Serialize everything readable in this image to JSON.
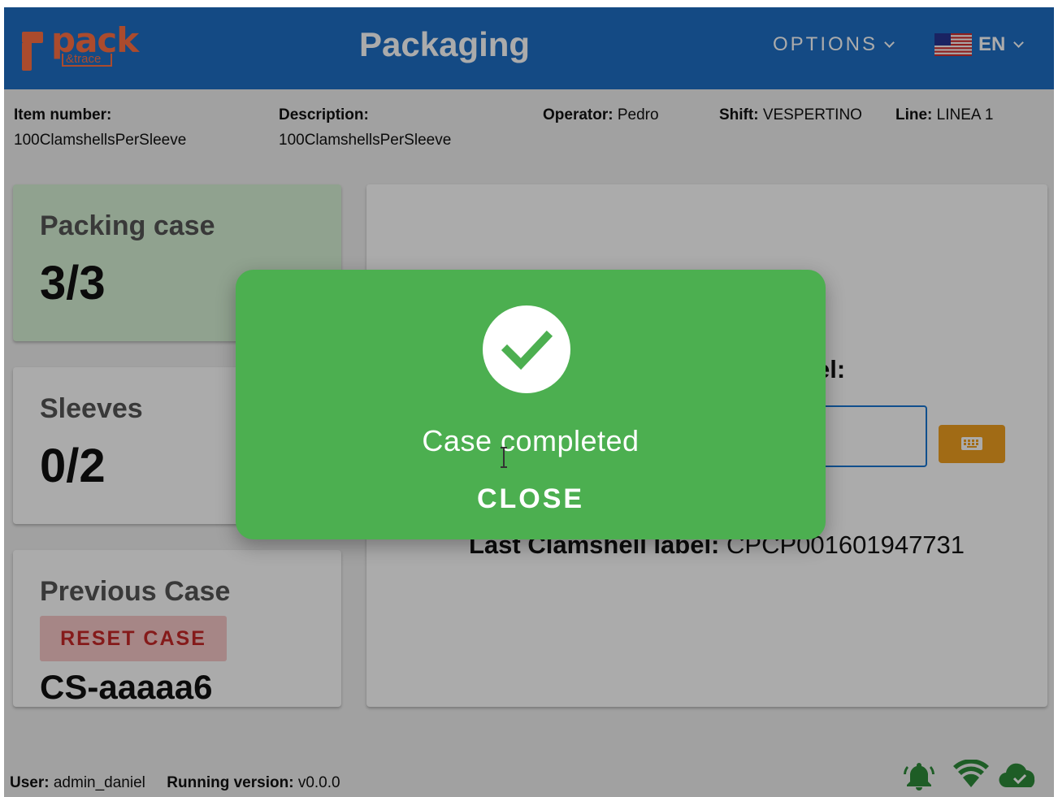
{
  "header": {
    "logo_text": "pack",
    "logo_subtext": "&trace",
    "title": "Packaging",
    "options_label": "OPTIONS",
    "language_label": "EN",
    "color": "#1f6fc5"
  },
  "info": {
    "item_number_label": "Item number:",
    "item_number_value": "100ClamshellsPerSleeve",
    "description_label": "Description:",
    "description_value": "100ClamshellsPerSleeve",
    "operator_label": "Operator:",
    "operator_value": "Pedro",
    "shift_label": "Shift:",
    "shift_value": "VESPERTINO",
    "line_label": "Line:",
    "line_value": "LINEA 1"
  },
  "cards": {
    "packing_case": {
      "title": "Packing case",
      "value": "3/3",
      "color": "#d7f2d5"
    },
    "sleeves": {
      "title": "Sleeves",
      "value": "0/2"
    },
    "previous_case": {
      "title": "Previous Case",
      "reset_label": "RESET CASE",
      "case_id": "CS-aaaaa6"
    }
  },
  "scan_panel": {
    "label_fragment": "el:",
    "last_label_prefix": "Last Clamshell label:",
    "last_label_value": "CPCP001601947731",
    "keyboard_icon": "keyboard-icon"
  },
  "dialog": {
    "icon": "check-circle-icon",
    "message": "Case completed",
    "close_label": "CLOSE",
    "color": "#4caf50"
  },
  "footer": {
    "user_label": "User:",
    "user_value": "admin_daniel",
    "version_label": "Running version:",
    "version_value": "v0.0.0",
    "icons": [
      "bell-icon",
      "wifi-icon",
      "cloud-check-icon"
    ]
  }
}
